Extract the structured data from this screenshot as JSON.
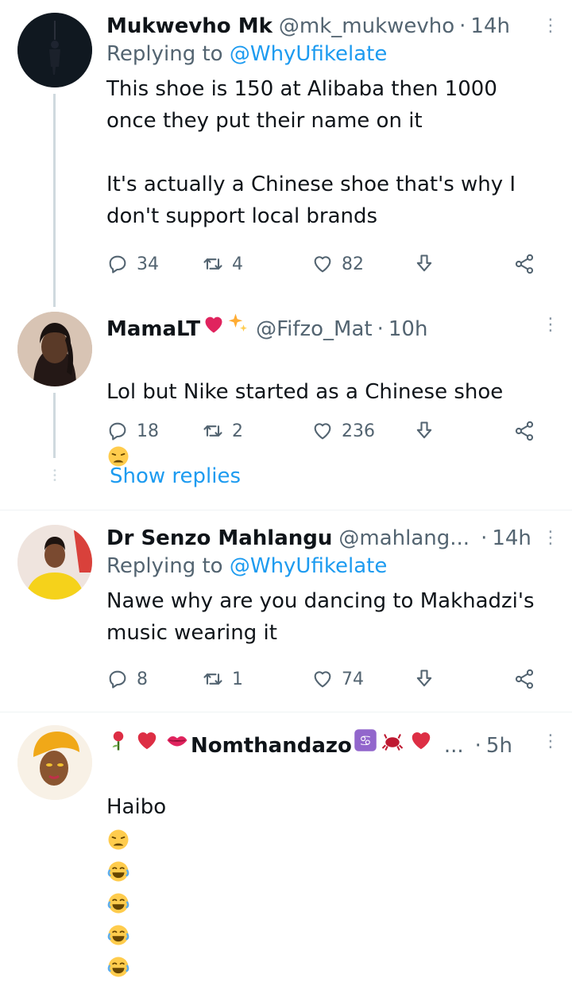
{
  "tweets": [
    {
      "name": "Mukwevho Mk",
      "handle": "@mk_mukwevho",
      "dot": "·",
      "time": "14h",
      "replying_prefix": "Replying to ",
      "replying_to": "@WhyUfikelate",
      "body": "This shoe is 150 at Alibaba then 1000\nonce they put their name on it\n\nIt's actually a Chinese shoe that's why I\ndon't support local brands",
      "replies": "34",
      "retweets": "4",
      "likes": "82"
    },
    {
      "name": "MamaLT",
      "handle": "@Fifzo_Mat",
      "dot": "·",
      "time": "10h",
      "body": "Lol but Nike started as a Chinese shoe",
      "replies": "18",
      "retweets": "2",
      "likes": "236",
      "show_replies": "Show replies"
    },
    {
      "name": "Dr Senzo Mahlangu",
      "handle": "@mahlang...",
      "dot": "·",
      "time": "14h",
      "replying_prefix": "Replying to ",
      "replying_to": "@WhyUfikelate",
      "body": "Nawe why are you dancing to Makhadzi's\nmusic wearing it",
      "replies": "8",
      "retweets": "1",
      "likes": "74"
    },
    {
      "name": "Nomthandazo",
      "handle": "...",
      "dot": "·",
      "time": "5h",
      "body": "Haibo"
    }
  ],
  "colors": {
    "accent": "#1d9bf0",
    "secondary_text": "#536471",
    "heart_red": "#e0245e"
  }
}
